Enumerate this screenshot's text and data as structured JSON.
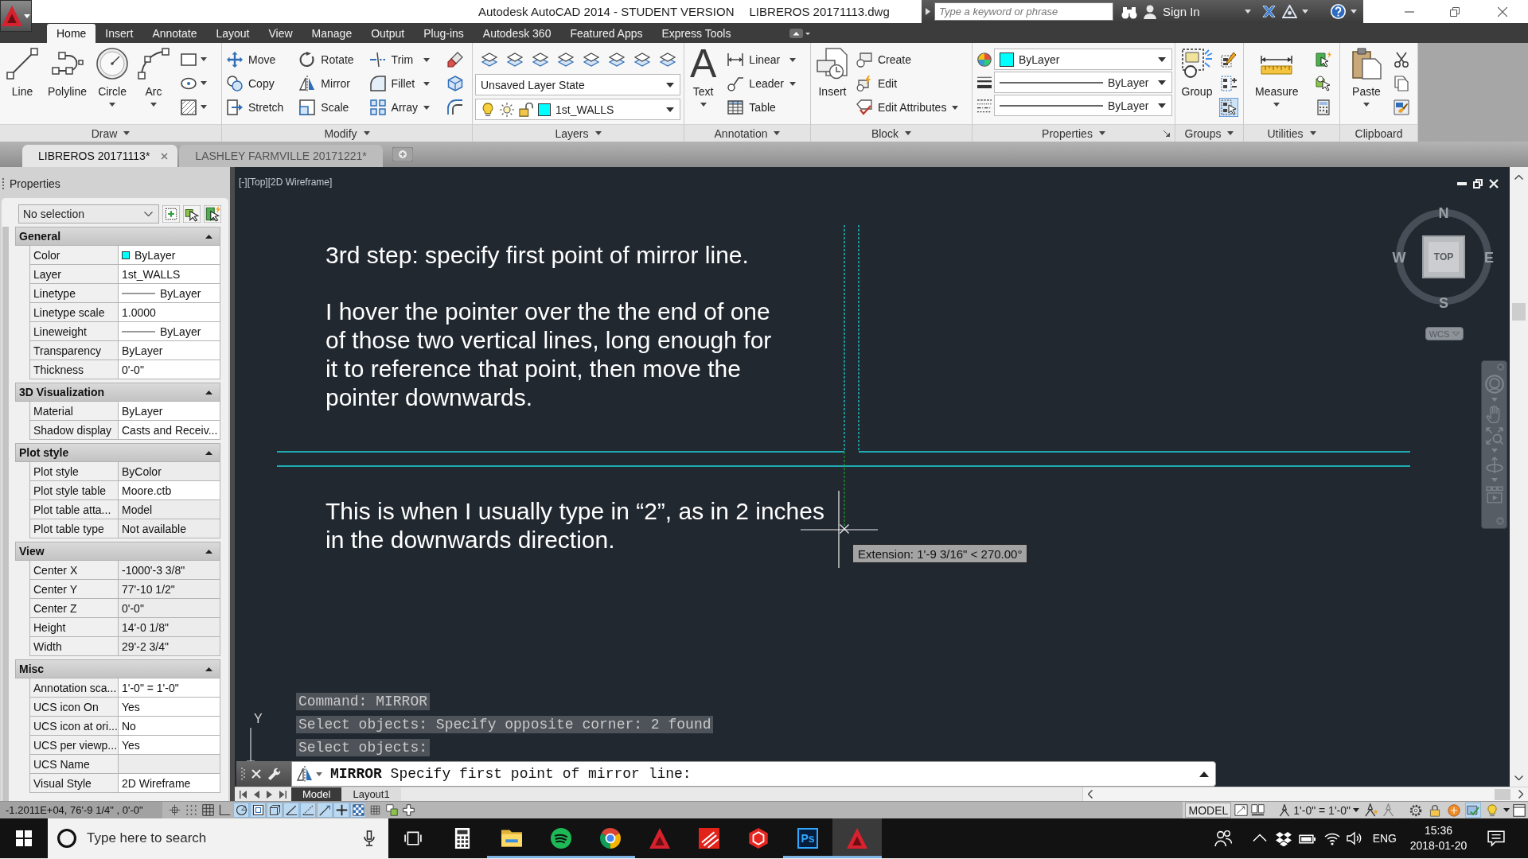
{
  "title_bar": {
    "app_title": "Autodesk AutoCAD 2014 - STUDENT VERSION",
    "file_name": "LIBREROS 20171113.dwg",
    "search": {
      "placeholder": "Type a keyword or phrase"
    },
    "sign_in": "Sign In"
  },
  "ribbon_tabs": [
    {
      "label": "Home",
      "selected": true
    },
    {
      "label": "Insert",
      "selected": false
    },
    {
      "label": "Annotate",
      "selected": false
    },
    {
      "label": "Layout",
      "selected": false
    },
    {
      "label": "View",
      "selected": false
    },
    {
      "label": "Manage",
      "selected": false
    },
    {
      "label": "Output",
      "selected": false
    },
    {
      "label": "Plug-ins",
      "selected": false
    },
    {
      "label": "Autodesk 360",
      "selected": false
    },
    {
      "label": "Featured Apps",
      "selected": false
    },
    {
      "label": "Express Tools",
      "selected": false
    }
  ],
  "ribbon_panels": [
    {
      "title": "Draw",
      "menu": true,
      "launcher": false,
      "columns": [
        {
          "kind": "large",
          "label": "Line",
          "dropdown": false
        },
        {
          "kind": "large",
          "label": "Polyline",
          "dropdown": false
        },
        {
          "kind": "large",
          "label": "Circle",
          "dropdown": true
        },
        {
          "kind": "large",
          "label": "Arc",
          "dropdown": true
        },
        {
          "kind": "tools",
          "buttons": [
            {
              "dropdown": true
            },
            {
              "dropdown": true
            },
            {
              "dropdown": true
            }
          ]
        }
      ]
    },
    {
      "title": "Modify",
      "menu": true,
      "launcher": false,
      "columns": [
        {
          "kind": "stack",
          "buttons": [
            {
              "label": "Move",
              "dropdown": false
            },
            {
              "label": "Copy",
              "dropdown": false
            },
            {
              "label": "Stretch",
              "dropdown": false
            }
          ]
        },
        {
          "kind": "stack",
          "buttons": [
            {
              "label": "Rotate",
              "dropdown": false
            },
            {
              "label": "Mirror",
              "dropdown": false
            },
            {
              "label": "Scale",
              "dropdown": false
            }
          ]
        },
        {
          "kind": "stack",
          "buttons": [
            {
              "label": "Trim",
              "dropdown": true
            },
            {
              "label": "Fillet",
              "dropdown": true
            },
            {
              "label": "Array",
              "dropdown": true
            }
          ]
        },
        {
          "kind": "tools",
          "buttons": [
            {
              "dropdown": false
            },
            {
              "dropdown": false
            },
            {
              "dropdown": false
            }
          ]
        }
      ]
    },
    {
      "title": "Layers",
      "menu": true,
      "launcher": false,
      "columns": [
        {
          "kind": "dropdowns",
          "tools": [
            {
              "dropdown": false
            },
            {
              "dropdown": false
            },
            {
              "dropdown": false
            },
            {
              "dropdown": false
            },
            {
              "dropdown": false
            },
            {
              "dropdown": false
            },
            {
              "dropdown": false
            },
            {
              "dropdown": false
            }
          ],
          "rows": [
            {
              "kind": "plain",
              "value": "Unsaved Layer State"
            },
            {
              "kind": "layer",
              "value": "1st_WALLS",
              "color": "#00ffff"
            }
          ]
        }
      ]
    },
    {
      "title": "Annotation",
      "menu": true,
      "launcher": false,
      "columns": [
        {
          "kind": "large",
          "glyph": "A",
          "label": "Text",
          "dropdown": true
        },
        {
          "kind": "stack",
          "buttons": [
            {
              "label": "Linear",
              "dropdown": true
            },
            {
              "label": "Leader",
              "dropdown": true
            },
            {
              "label": "Table",
              "dropdown": false
            }
          ]
        }
      ]
    },
    {
      "title": "Block",
      "menu": true,
      "launcher": false,
      "columns": [
        {
          "kind": "large",
          "label": "Insert",
          "dropdown": false
        },
        {
          "kind": "stack",
          "buttons": [
            {
              "label": "Create",
              "dropdown": false
            },
            {
              "label": "Edit",
              "dropdown": false
            },
            {
              "label": "Edit Attributes",
              "dropdown": true
            }
          ]
        }
      ]
    },
    {
      "title": "Properties",
      "menu": true,
      "launcher": true,
      "columns": [
        {
          "kind": "dropdowns",
          "rows": [
            {
              "kind": "color",
              "value": "ByLayer",
              "color": "#00ffff"
            },
            {
              "kind": "lineweight",
              "value": "ByLayer"
            },
            {
              "kind": "linetype",
              "value": "ByLayer"
            }
          ]
        }
      ]
    },
    {
      "title": "Groups",
      "menu": true,
      "launcher": false,
      "columns": [
        {
          "kind": "large",
          "label": "Group",
          "dropdown": false
        },
        {
          "kind": "tools",
          "buttons": [
            {
              "dropdown": false,
              "on": false
            },
            {
              "dropdown": false,
              "on": false
            },
            {
              "dropdown": false,
              "on": true
            }
          ]
        }
      ]
    },
    {
      "title": "Utilities",
      "menu": true,
      "launcher": false,
      "columns": [
        {
          "kind": "large",
          "label": "Measure",
          "dropdown": true
        },
        {
          "kind": "tools",
          "buttons": [
            {
              "dropdown": false
            },
            {
              "dropdown": false
            },
            {
              "dropdown": false
            }
          ]
        }
      ]
    },
    {
      "title": "Clipboard",
      "menu": false,
      "launcher": false,
      "columns": [
        {
          "kind": "large",
          "label": "Paste",
          "dropdown": true
        },
        {
          "kind": "tools",
          "buttons": [
            {
              "dropdown": false
            },
            {
              "dropdown": false
            },
            {
              "dropdown": false
            }
          ]
        }
      ]
    }
  ],
  "document_tabs": [
    {
      "label": "LIBREROS 20171113*",
      "selected": true
    },
    {
      "label": "LASHLEY FARMVILLE 20171221*",
      "selected": false
    }
  ],
  "properties_palette": {
    "title": "Properties",
    "selection": "No selection",
    "sections": [
      {
        "title": "General",
        "expanded": true,
        "rows": [
          {
            "kind": "color",
            "label": "Color",
            "value": "ByLayer",
            "color": "#00ffff",
            "read_only": false
          },
          {
            "kind": "text",
            "label": "Layer",
            "value": "1st_WALLS",
            "read_only": false
          },
          {
            "kind": "line",
            "label": "Linetype",
            "value": "ByLayer",
            "read_only": false
          },
          {
            "kind": "text",
            "label": "Linetype scale",
            "value": "1.0000",
            "read_only": false
          },
          {
            "kind": "line",
            "label": "Lineweight",
            "value": "ByLayer",
            "read_only": false
          },
          {
            "kind": "text",
            "label": "Transparency",
            "value": "ByLayer",
            "read_only": false
          },
          {
            "kind": "text",
            "label": "Thickness",
            "value": "0'-0\"",
            "read_only": false
          }
        ]
      },
      {
        "title": "3D Visualization",
        "expanded": true,
        "rows": [
          {
            "kind": "text",
            "label": "Material",
            "value": "ByLayer",
            "read_only": false
          },
          {
            "kind": "text",
            "label": "Shadow display",
            "value": "Casts and Receiv...",
            "read_only": false
          }
        ]
      },
      {
        "title": "Plot style",
        "expanded": true,
        "rows": [
          {
            "kind": "text",
            "label": "Plot style",
            "value": "ByColor",
            "read_only": true
          },
          {
            "kind": "text",
            "label": "Plot style table",
            "value": "Moore.ctb",
            "read_only": false
          },
          {
            "kind": "text",
            "label": "Plot table atta...",
            "value": "Model",
            "read_only": true
          },
          {
            "kind": "text",
            "label": "Plot table type",
            "value": "Not available",
            "read_only": true
          }
        ]
      },
      {
        "title": "View",
        "expanded": true,
        "rows": [
          {
            "kind": "text",
            "label": "Center X",
            "value": "-1000'-3 3/8\"",
            "read_only": true
          },
          {
            "kind": "text",
            "label": "Center Y",
            "value": "77'-10 1/2\"",
            "read_only": true
          },
          {
            "kind": "text",
            "label": "Center Z",
            "value": "0'-0\"",
            "read_only": true
          },
          {
            "kind": "text",
            "label": "Height",
            "value": "14'-0 1/8\"",
            "read_only": true
          },
          {
            "kind": "text",
            "label": "Width",
            "value": "29'-2 3/4\"",
            "read_only": true
          }
        ]
      },
      {
        "title": "Misc",
        "expanded": true,
        "rows": [
          {
            "kind": "text",
            "label": "Annotation sca...",
            "value": "1'-0\" = 1'-0\"",
            "read_only": false
          },
          {
            "kind": "text",
            "label": "UCS icon On",
            "value": "Yes",
            "read_only": false
          },
          {
            "kind": "text",
            "label": "UCS icon at ori...",
            "value": "No",
            "read_only": false
          },
          {
            "kind": "text",
            "label": "UCS per viewp...",
            "value": "Yes",
            "read_only": false
          },
          {
            "kind": "text",
            "label": "UCS Name",
            "read_only": true
          },
          {
            "kind": "text",
            "label": "Visual Style",
            "value": "2D Wireframe",
            "read_only": false
          }
        ]
      }
    ]
  },
  "drawing": {
    "viewport_label": "[-][Top][2D Wireframe]",
    "notes": [
      {
        "lines": [
          "3rd step: specify first point of mirror line."
        ]
      },
      {
        "lines": [
          "I hover the pointer over the the end of one",
          "of those two vertical lines, long enough for",
          "it to reference that point, then move the",
          "pointer downwards."
        ]
      },
      {
        "lines": [
          "This is when I usually type in “2”, as in 2 inches",
          "in the downwards direction."
        ]
      }
    ],
    "tooltip": "Extension: 1'-9 3/16\" < 270.00°",
    "ucs_label": "Y",
    "viewcube": {
      "face": "TOP",
      "compass": [
        "N",
        "E",
        "S",
        "W"
      ],
      "coordinate_system": "WCS"
    },
    "command_history": [
      "Command: MIRROR",
      "Select objects: Specify opposite corner: 2 found",
      "Select objects:"
    ],
    "command_line": "**MIRROR** Specify first point of mirror line:"
  },
  "layout_tabs": [
    {
      "label": "Model",
      "selected": true
    },
    {
      "label": "Layout1",
      "selected": false
    }
  ],
  "status_bar": {
    "coordinates": "-1.2011E+04, 76'-9 1/4\" , 0'-0\"",
    "toggles": [
      {
        "on": false
      },
      {
        "on": false
      },
      {
        "on": false
      },
      {
        "on": false
      },
      {
        "on": true
      },
      {
        "on": true
      },
      {
        "on": true
      },
      {
        "on": true
      },
      {
        "on": true
      },
      {
        "on": true
      },
      {
        "on": true
      },
      {
        "on": true
      },
      {
        "on": false
      },
      {
        "on": false
      },
      {
        "on": false
      }
    ],
    "space": "MODEL",
    "annotation_scale": "1'-0\" = 1'-0\"",
    "tools": [
      {
        "on": false
      },
      {
        "on": false
      },
      {
        "on": false
      },
      {
        "on": true
      },
      {
        "on": false
      }
    ]
  },
  "taskbar": {
    "search": {
      "placeholder": "Type here to search"
    },
    "apps": [
      {
        "running": false,
        "selected": false
      },
      {
        "running": true,
        "selected": false
      },
      {
        "running": true,
        "selected": false
      },
      {
        "running": true,
        "selected": false
      },
      {
        "running": false,
        "selected": false
      },
      {
        "running": false,
        "selected": false
      },
      {
        "running": false,
        "selected": false
      },
      {
        "label": "Ps",
        "running": true,
        "selected": false
      },
      {
        "running": true,
        "selected": true
      }
    ],
    "language": "ENG",
    "time": "15:36",
    "date": "2018-01-20"
  }
}
